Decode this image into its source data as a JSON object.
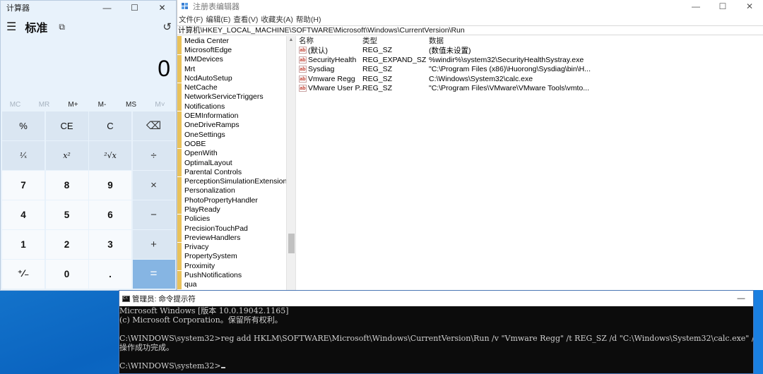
{
  "calculator": {
    "title": "计算器",
    "mode": "标准",
    "menu_icon": "hamburger-icon",
    "keep_on_top_icon": "keep-on-top-icon",
    "history_icon": "history-icon",
    "display": "0",
    "memory": [
      "MC",
      "MR",
      "M+",
      "M-",
      "MS",
      "M˅"
    ],
    "keys": [
      "%",
      "CE",
      "C",
      "⌫",
      "¹⁄ₓ",
      "x²",
      "²√x",
      "÷",
      "7",
      "8",
      "9",
      "×",
      "4",
      "5",
      "6",
      "−",
      "1",
      "2",
      "3",
      "+",
      "⁺⁄₋",
      "0",
      ".",
      "="
    ],
    "window_controls": [
      "—",
      "☐",
      "✕"
    ]
  },
  "regedit": {
    "title": "注册表编辑器",
    "menu": [
      "文件(F)",
      "编辑(E)",
      "查看(V)",
      "收藏夹(A)",
      "帮助(H)"
    ],
    "address": "计算机\\HKEY_LOCAL_MACHINE\\SOFTWARE\\Microsoft\\Windows\\CurrentVersion\\Run",
    "tree": [
      "Media Center",
      "MicrosoftEdge",
      "MMDevices",
      "Mrt",
      "NcdAutoSetup",
      "NetCache",
      "NetworkServiceTriggers",
      "Notifications",
      "OEMInformation",
      "OneDriveRamps",
      "OneSettings",
      "OOBE",
      "OpenWith",
      "OptimalLayout",
      "Parental Controls",
      "PerceptionSimulationExtensions",
      "Personalization",
      "PhotoPropertyHandler",
      "PlayReady",
      "Policies",
      "PrecisionTouchPad",
      "PreviewHandlers",
      "Privacy",
      "PropertySystem",
      "Proximity",
      "PushNotifications",
      "qua"
    ],
    "columns": [
      "名称",
      "类型",
      "数据"
    ],
    "values": [
      {
        "name": "(默认)",
        "type": "REG_SZ",
        "data": "(数值未设置)"
      },
      {
        "name": "SecurityHealth",
        "type": "REG_EXPAND_SZ",
        "data": "%windir%\\system32\\SecurityHealthSystray.exe"
      },
      {
        "name": "Sysdiag",
        "type": "REG_SZ",
        "data": "\"C:\\Program Files (x86)\\Huorong\\Sysdiag\\bin\\H..."
      },
      {
        "name": "Vmware Regg",
        "type": "REG_SZ",
        "data": "C:\\Windows\\System32\\calc.exe"
      },
      {
        "name": "VMware User P...",
        "type": "REG_SZ",
        "data": "\"C:\\Program Files\\VMware\\VMware Tools\\vmto..."
      }
    ],
    "window_controls": [
      "—",
      "☐",
      "✕"
    ]
  },
  "cmd": {
    "title": "管理员: 命令提示符",
    "lines": [
      "Microsoft Windows [版本 10.0.19042.1165]",
      "(c) Microsoft Corporation。保留所有权利。",
      "",
      "C:\\WINDOWS\\system32>reg add HKLM\\SOFTWARE\\Microsoft\\Windows\\CurrentVersion\\Run /v \"Vmware Regg\" /t REG_SZ /d \"C:\\Windows\\System32\\calc.exe\" /f",
      "操作成功完成。",
      "",
      "C:\\WINDOWS\\system32>"
    ],
    "window_controls": [
      "—",
      "☐",
      "✕"
    ]
  }
}
